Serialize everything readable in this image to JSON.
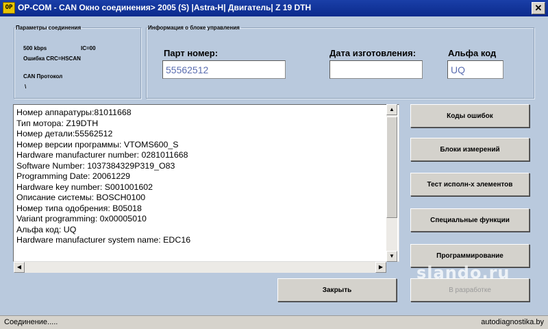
{
  "window": {
    "icon_text": "OP",
    "title": "OP-COM - CAN Окно соединения> 2005 (S) |Astra-H| Двигатель| Z 19 DTH",
    "close_glyph": "✕"
  },
  "connection": {
    "legend": "Параметры соединения",
    "speed": "500 kbps",
    "ic": "IC=00",
    "error": "Ошибка CRC=HSCAN",
    "protocol_label": "CAN Протокол",
    "protocol_value": "\\"
  },
  "ecu_info": {
    "legend": "Информация о блоке управления",
    "part_label": "Парт номер:",
    "part_value": "55562512",
    "date_label": "Дата изготовления:",
    "date_value": "",
    "alpha_label": "Альфа код",
    "alpha_value": "UQ"
  },
  "details": [
    "Номер аппаратуры:81011668",
    "Тип мотора: Z19DTH",
    "Номер детали:55562512",
    "Номер версии программы: VTOMS600_S",
    "Hardware manufacturer number: 0281011668",
    "Software Number: 1037384329P319_O83",
    "Programming Date: 20061229",
    "Hardware key number: S001001602",
    "Описание системы: BOSCH0100",
    "Номер типа одобрения: B05018",
    "Variant programming: 0x00005010",
    "Альфа код: UQ",
    "Hardware manufacturer system name: EDC16"
  ],
  "buttons": {
    "error_codes": "Коды ошибок",
    "measure_blocks": "Блоки измерений",
    "actuator_test": "Тест исполн-х элементов",
    "special_functions": "Специальные функции",
    "programming": "Программирование",
    "close": "Закрыть",
    "in_development": "В разработке"
  },
  "watermark": "slando.ru",
  "status": {
    "left": "Соединение.....",
    "right": "autodiagnostika.by"
  },
  "colors": {
    "background": "#b9c9dd",
    "titlebar": "#1a3fa8",
    "input_text": "#5a6db0"
  }
}
